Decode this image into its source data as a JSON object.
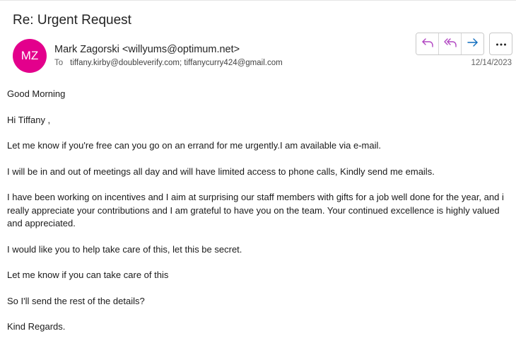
{
  "email": {
    "subject": "Re: Urgent Request",
    "avatar_initials": "MZ",
    "avatar_color": "#e3008c",
    "sender": "Mark Zagorski <willyums@optimum.net>",
    "to_label": "To",
    "recipients": "tiffany.kirby@doubleverify.com; tiffanycurry424@gmail.com",
    "date": "12/14/2023"
  },
  "actions": {
    "reply_icon": "reply-icon",
    "reply_all_icon": "reply-all-icon",
    "forward_icon": "forward-icon",
    "more_icon": "more-icon"
  },
  "colors": {
    "reply_accent": "#b146c2",
    "forward_accent": "#0f6cbd"
  },
  "body": {
    "p0": "Good Morning",
    "p1": "Hi Tiffany ,",
    "p2": "Let me know if you're free can you go on an errand for me urgently.I am available via e-mail.",
    "p3": "I will be in and out of meetings all day and will have limited access to phone calls, Kindly send me emails.",
    "p4": "I have been working on incentives and I aim at surprising our staff members with gifts for a job well done for the year, and i really appreciate your contributions and I am grateful to have you on the team. Your continued excellence is highly valued and appreciated.",
    "p5": "I would like you to help take care of this, let this be secret.",
    "p6": "Let me know if you can take care of this",
    "p7": "So I'll send the rest of the details?",
    "p8": "Kind Regards."
  }
}
